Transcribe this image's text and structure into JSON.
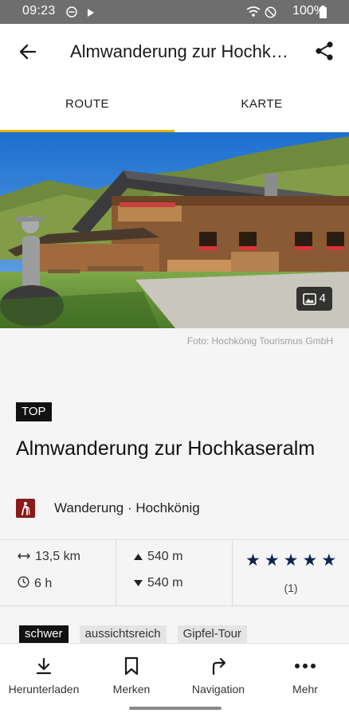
{
  "status_bar": {
    "time": "09:23",
    "battery": "100%"
  },
  "app_bar": {
    "title": "Almwanderung zur Hochkaseralm",
    "back_icon": "arrow-left-icon",
    "share_icon": "share-icon"
  },
  "tabs": [
    {
      "label": "ROUTE",
      "active": true
    },
    {
      "label": "KARTE",
      "active": false
    }
  ],
  "photo": {
    "count": "4",
    "credit": "Foto: Hochkönig Tourismus GmbH"
  },
  "badge": "TOP",
  "tour": {
    "title": "Almwanderung zur Hochkaseralm",
    "category": "Wanderung · Hochkönig",
    "category_color": "#8b1a1a"
  },
  "stats": {
    "distance": "13,5 km",
    "duration": "6 h",
    "ascent": "540 m",
    "descent": "540 m",
    "rating_stars": 5,
    "rating_count": "(1)",
    "star_color": "#0e2350"
  },
  "tags": [
    {
      "label": "schwer",
      "highlight": true
    },
    {
      "label": "aussichtsreich",
      "highlight": false
    },
    {
      "label": "Gipfel-Tour",
      "highlight": false
    }
  ],
  "bottom_nav": [
    {
      "label": "Herunterladen",
      "icon": "download-icon"
    },
    {
      "label": "Merken",
      "icon": "bookmark-icon"
    },
    {
      "label": "Navigation",
      "icon": "turn-right-arrow-icon"
    },
    {
      "label": "Mehr",
      "icon": "more-dots-icon"
    }
  ],
  "accent_color": "#e8b400"
}
